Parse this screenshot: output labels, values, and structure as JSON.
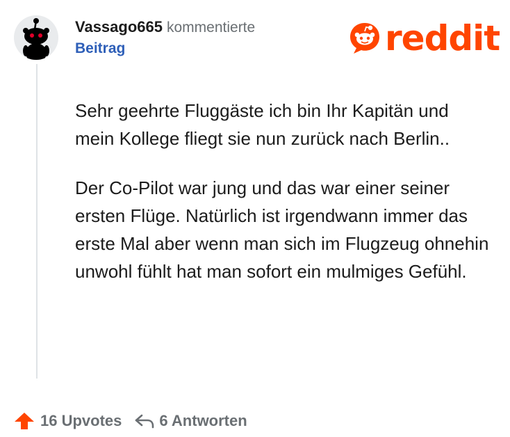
{
  "comment": {
    "author": "Vassago665",
    "action": "kommentierte",
    "context_link": "Beitrag",
    "paragraphs": [
      "Sehr geehrte Fluggäste ich bin Ihr Kapitän und mein Kollege fliegt sie nun zurück nach Berlin..",
      "Der Co-Pilot war jung und das war einer seiner ersten Flüge. Natürlich ist irgendwann immer das erste Mal aber wenn man sich im Flugzeug ohnehin unwohl fühlt hat man sofort ein mulmiges Gefühl."
    ]
  },
  "brand": {
    "logo_text": "reddit",
    "color": "#ff4500"
  },
  "footer": {
    "upvotes_label": "16 Upvotes",
    "replies_label": "6 Antworten",
    "upvote_icon": "upvote-arrow-icon",
    "reply_icon": "reply-arrow-icon"
  }
}
